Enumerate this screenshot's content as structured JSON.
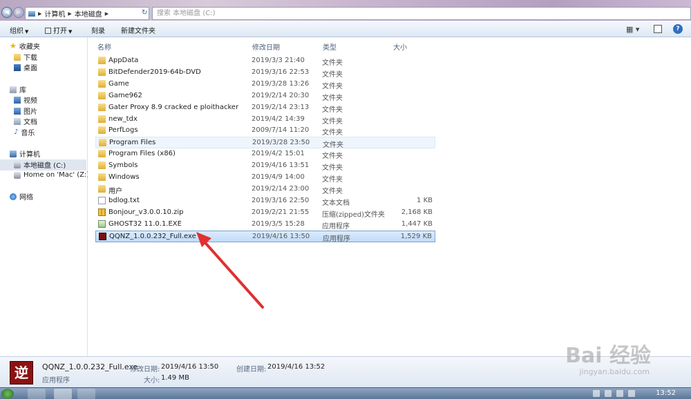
{
  "address": {
    "crumbs": [
      "计算机",
      "本地磁盘"
    ],
    "search_placeholder": "搜索 本地磁盘 (C:)"
  },
  "toolbar": {
    "organize": "组织",
    "open": "打开",
    "burn": "刻录",
    "new_folder": "新建文件夹"
  },
  "nav": {
    "favorites": "收藏夹",
    "downloads": "下载",
    "desktop": "桌面",
    "libraries": "库",
    "videos": "视频",
    "pictures": "图片",
    "documents": "文档",
    "music": "音乐",
    "computer": "计算机",
    "local_disk": "本地磁盘 (C:)",
    "mac_share": "Home on 'Mac' (Z:)",
    "network": "网络"
  },
  "columns": {
    "name": "名称",
    "modified": "修改日期",
    "type": "类型",
    "size": "大小"
  },
  "files": [
    {
      "name": "AppData",
      "modified": "2019/3/3 21:40",
      "type": "文件夹",
      "size": "",
      "icon": "folder-icon"
    },
    {
      "name": "BitDefender2019-64b-DVD",
      "modified": "2019/3/16 22:53",
      "type": "文件夹",
      "size": "",
      "icon": "folder-icon"
    },
    {
      "name": "Game",
      "modified": "2019/3/28 13:26",
      "type": "文件夹",
      "size": "",
      "icon": "folder-icon"
    },
    {
      "name": "Game962",
      "modified": "2019/2/14 20:30",
      "type": "文件夹",
      "size": "",
      "icon": "folder-icon"
    },
    {
      "name": "Gater Proxy 8.9 cracked e ploithacker",
      "modified": "2019/2/14 23:13",
      "type": "文件夹",
      "size": "",
      "icon": "folder-icon"
    },
    {
      "name": "new_tdx",
      "modified": "2019/4/2 14:39",
      "type": "文件夹",
      "size": "",
      "icon": "folder-icon"
    },
    {
      "name": "PerfLogs",
      "modified": "2009/7/14 11:20",
      "type": "文件夹",
      "size": "",
      "icon": "folder-icon"
    },
    {
      "name": "Program Files",
      "modified": "2019/3/28 23:50",
      "type": "文件夹",
      "size": "",
      "icon": "folder-icon"
    },
    {
      "name": "Program Files (x86)",
      "modified": "2019/4/2 15:01",
      "type": "文件夹",
      "size": "",
      "icon": "folder-icon"
    },
    {
      "name": "Symbols",
      "modified": "2019/4/16 13:51",
      "type": "文件夹",
      "size": "",
      "icon": "folder-icon"
    },
    {
      "name": "Windows",
      "modified": "2019/4/9 14:00",
      "type": "文件夹",
      "size": "",
      "icon": "folder-icon"
    },
    {
      "name": "用户",
      "modified": "2019/2/14 23:00",
      "type": "文件夹",
      "size": "",
      "icon": "folder-icon"
    },
    {
      "name": "bdlog.txt",
      "modified": "2019/3/16 22:50",
      "type": "文本文档",
      "size": "1 KB",
      "icon": "text-file-icon"
    },
    {
      "name": "Bonjour_v3.0.0.10.zip",
      "modified": "2019/2/21 21:55",
      "type": "压缩(zipped)文件夹",
      "size": "2,168 KB",
      "icon": "zip-file-icon"
    },
    {
      "name": "GHOST32 11.0.1.EXE",
      "modified": "2019/3/5 15:28",
      "type": "应用程序",
      "size": "1,447 KB",
      "icon": "ghost-exe-icon"
    },
    {
      "name": "QQNZ_1.0.0.232_Full.exe",
      "modified": "2019/4/16 13:50",
      "type": "应用程序",
      "size": "1,529 KB",
      "icon": "qqnz-exe-icon"
    }
  ],
  "details": {
    "filename": "QQNZ_1.0.0.232_Full.exe",
    "modified_label": "修改日期:",
    "modified_value": "2019/4/16 13:50",
    "created_label": "创建日期:",
    "created_value": "2019/4/16 13:52",
    "type": "应用程序",
    "size_label": "大小:",
    "size_value": "1.49 MB"
  },
  "watermark": {
    "brand": "Bai 经验",
    "url": "jingyan.baidu.com"
  },
  "taskbar": {
    "clock": "13:52"
  },
  "colors": {
    "selection": "#c1dcfc",
    "annotation_arrow": "#e03030"
  }
}
